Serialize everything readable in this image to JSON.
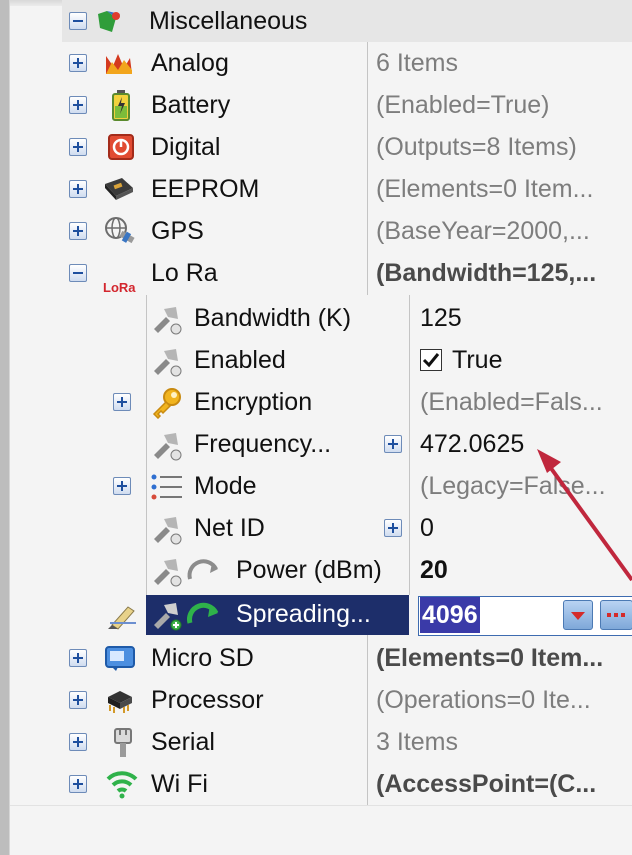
{
  "colors": {
    "panel_bg": "#f4f4f4",
    "selected_row": "#1d2e6a",
    "edit_selection": "#3a3aa8",
    "annotation_arrow": "#c0273d"
  },
  "tree": {
    "root": {
      "label": "Miscellaneous",
      "icon": "puzzle-icon",
      "expanded": true
    },
    "items": [
      {
        "label": "Analog",
        "value": "6 Items",
        "icon": "analog-wave-icon"
      },
      {
        "label": "Battery",
        "value": "(Enabled=True)",
        "icon": "battery-icon"
      },
      {
        "label": "Digital",
        "value": "(Outputs=8 Items)",
        "icon": "digital-io-icon"
      },
      {
        "label": "EEPROM",
        "value": "(Elements=0 Item...",
        "icon": "eeprom-chip-icon"
      },
      {
        "label": "GPS",
        "value": "(BaseYear=2000,...",
        "icon": "gps-satellite-icon"
      },
      {
        "label": "Lo Ra",
        "value": "(Bandwidth=125,...",
        "icon": "lora-icon",
        "icon_text": "LoRa",
        "expanded": true
      }
    ],
    "lora_children": [
      {
        "label": "Bandwidth (K)",
        "value": "125",
        "icon": "property-pin-icon"
      },
      {
        "label": "Enabled",
        "value": "True",
        "icon": "property-pin-icon",
        "checked": true
      },
      {
        "label": "Encryption",
        "value": "(Enabled=Fals...",
        "icon": "key-icon"
      },
      {
        "label": "Frequency...",
        "value": "472.0625",
        "icon": "property-pin-icon"
      },
      {
        "label": "Mode",
        "value": "(Legacy=False...",
        "icon": "list-icon"
      },
      {
        "label": "Net ID",
        "value": "0",
        "icon": "property-pin-icon"
      },
      {
        "label": "Power (dBm)",
        "value": "20",
        "icon": "power-arc-icon"
      },
      {
        "label": "Spreading...",
        "value": "4096",
        "icon": "spreading-arrow-icon",
        "selected": true
      }
    ],
    "items_after": [
      {
        "label": "Micro SD",
        "value": "(Elements=0 Item...",
        "icon": "sd-card-icon"
      },
      {
        "label": "Processor",
        "value": "(Operations=0 Ite...",
        "icon": "processor-chip-icon"
      },
      {
        "label": "Serial",
        "value": "3 Items",
        "icon": "serial-plug-icon"
      },
      {
        "label": "Wi Fi",
        "value": "(AccessPoint=(C...",
        "icon": "wifi-icon"
      }
    ]
  }
}
